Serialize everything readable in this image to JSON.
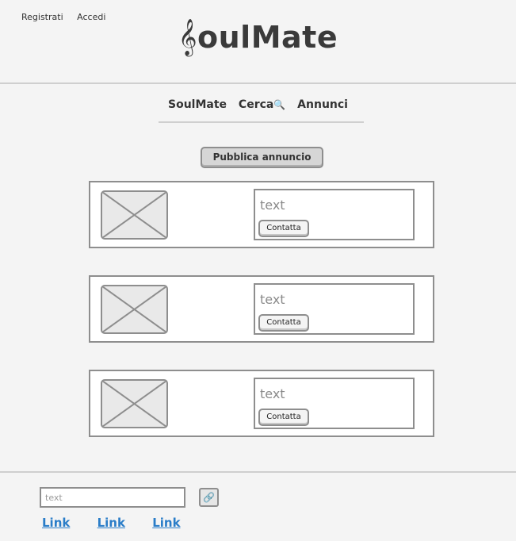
{
  "header": {
    "auth": {
      "register_label": "Registrati",
      "login_label": "Accedi"
    },
    "logo": {
      "clef": "𝄞",
      "text": "oulMate"
    }
  },
  "nav": {
    "items": [
      {
        "label": "SoulMate"
      },
      {
        "label": "Cerca",
        "icon": "search-icon"
      },
      {
        "label": "Annunci"
      }
    ]
  },
  "publish_button": {
    "label": "Pubblica annuncio"
  },
  "ads": [
    {
      "text": "text",
      "contact_label": "Contatta"
    },
    {
      "text": "text",
      "contact_label": "Contatta"
    },
    {
      "text": "text",
      "contact_label": "Contatta"
    }
  ],
  "footer": {
    "input": {
      "placeholder": "text",
      "value": ""
    },
    "icon_button": {
      "icon": "link-icon"
    },
    "links": [
      {
        "label": "Link"
      },
      {
        "label": "Link"
      },
      {
        "label": "Link"
      }
    ]
  },
  "colors": {
    "link": "#2a7dc8",
    "border": "#8e8e8e",
    "background": "#f4f4f4"
  }
}
